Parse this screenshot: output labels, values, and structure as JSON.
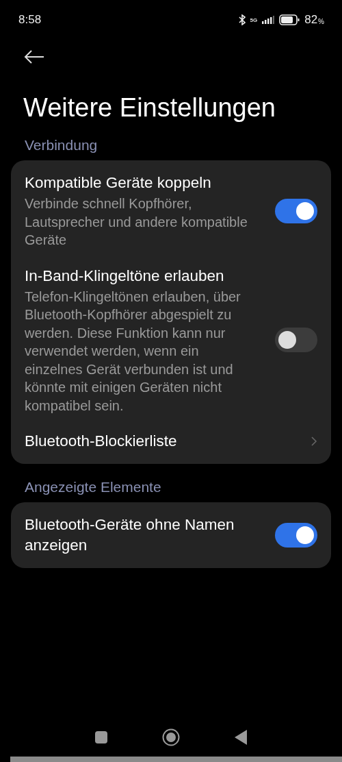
{
  "status_bar": {
    "time": "8:58",
    "network": "5G",
    "battery": "82",
    "battery_unit": "%"
  },
  "title": "Weitere Einstellungen",
  "sections": [
    {
      "header": "Verbindung",
      "items": [
        {
          "kind": "toggle",
          "title": "Kompatible Geräte koppeln",
          "subtitle": "Verbinde schnell Kopfhörer, Lautsprecher und andere kompatible Geräte",
          "on": true
        },
        {
          "kind": "toggle",
          "title": "In-Band-Klingeltöne erlauben",
          "subtitle": "Telefon-Klingeltönen erlauben, über Bluetooth-Kopfhörer abgespielt zu werden. Diese Funktion kann nur verwendet werden, wenn ein einzelnes Gerät verbunden ist und könnte mit einigen Geräten nicht kompatibel sein.",
          "on": false
        },
        {
          "kind": "link",
          "title": "Bluetooth-Blockierliste"
        }
      ]
    },
    {
      "header": "Angezeigte Elemente",
      "items": [
        {
          "kind": "toggle",
          "title": "Bluetooth-Geräte ohne Namen anzeigen",
          "on": true
        }
      ]
    }
  ]
}
